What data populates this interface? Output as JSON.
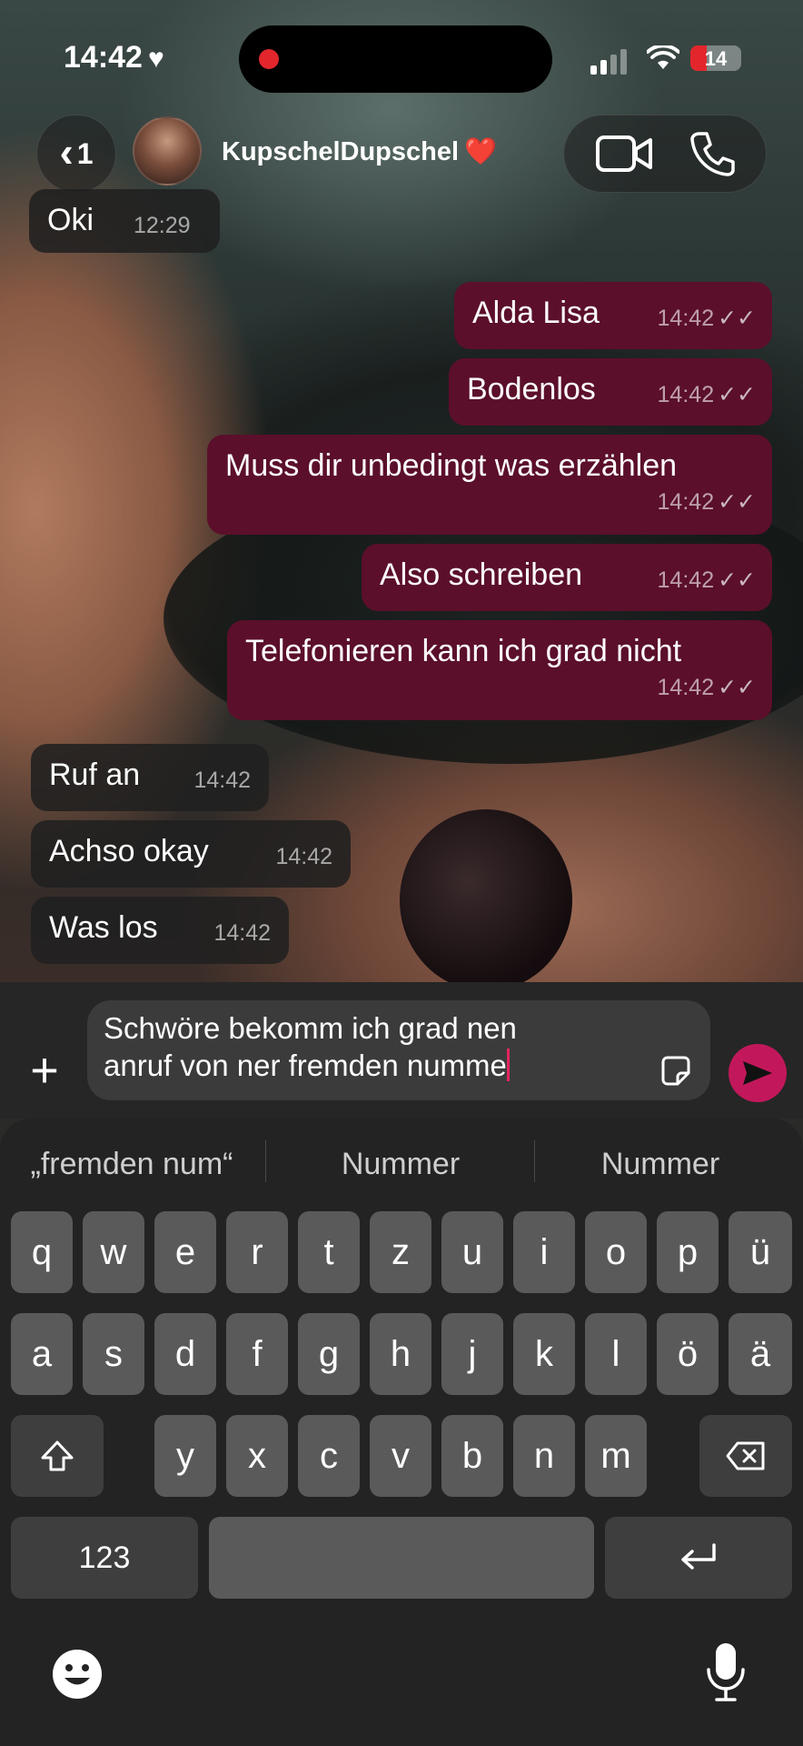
{
  "status_bar": {
    "time": "14:42",
    "time_icon": "heart-icon",
    "battery": "14",
    "battery_color": "#e2262c"
  },
  "header": {
    "back_count": "1",
    "contact_name": "KupschelDupschel",
    "contact_emoji": "❤️",
    "video_icon": "video-camera-icon",
    "phone_icon": "phone-icon"
  },
  "messages": [
    {
      "direction": "in",
      "text": "Oki",
      "time": "12:29"
    },
    {
      "direction": "out",
      "text": "Alda Lisa",
      "time": "14:42",
      "status": "read"
    },
    {
      "direction": "out",
      "text": "Bodenlos",
      "time": "14:42",
      "status": "read"
    },
    {
      "direction": "out",
      "text": "Muss dir unbedingt was erzählen",
      "time": "14:42",
      "status": "read"
    },
    {
      "direction": "out",
      "text": "Also schreiben",
      "time": "14:42",
      "status": "read"
    },
    {
      "direction": "out",
      "text": "Telefonieren kann ich grad nicht",
      "time": "14:42",
      "status": "read"
    },
    {
      "direction": "in",
      "text": "Ruf an",
      "time": "14:42"
    },
    {
      "direction": "in",
      "text": "Achso okay",
      "time": "14:42"
    },
    {
      "direction": "in",
      "text": "Was los",
      "time": "14:42"
    }
  ],
  "composer": {
    "plus_icon": "plus-icon",
    "line1": "Schwöre bekomm ich grad nen",
    "line2": "anruf von ner fremden numme",
    "sticker_icon": "sticker-icon",
    "send_icon": "send-icon",
    "accent": "#c2185b"
  },
  "keyboard": {
    "suggestions": [
      "„fremden num“",
      "Nummer",
      "Nummer"
    ],
    "row1": [
      "q",
      "w",
      "e",
      "r",
      "t",
      "z",
      "u",
      "i",
      "o",
      "p",
      "ü"
    ],
    "row2": [
      "a",
      "s",
      "d",
      "f",
      "g",
      "h",
      "j",
      "k",
      "l",
      "ö",
      "ä"
    ],
    "row3": [
      "y",
      "x",
      "c",
      "v",
      "b",
      "n",
      "m"
    ],
    "numbers_key": "123",
    "shift_icon": "shift-icon",
    "backspace_icon": "backspace-icon",
    "return_icon": "return-icon",
    "emoji_icon": "emoji-icon",
    "mic_icon": "microphone-icon"
  }
}
